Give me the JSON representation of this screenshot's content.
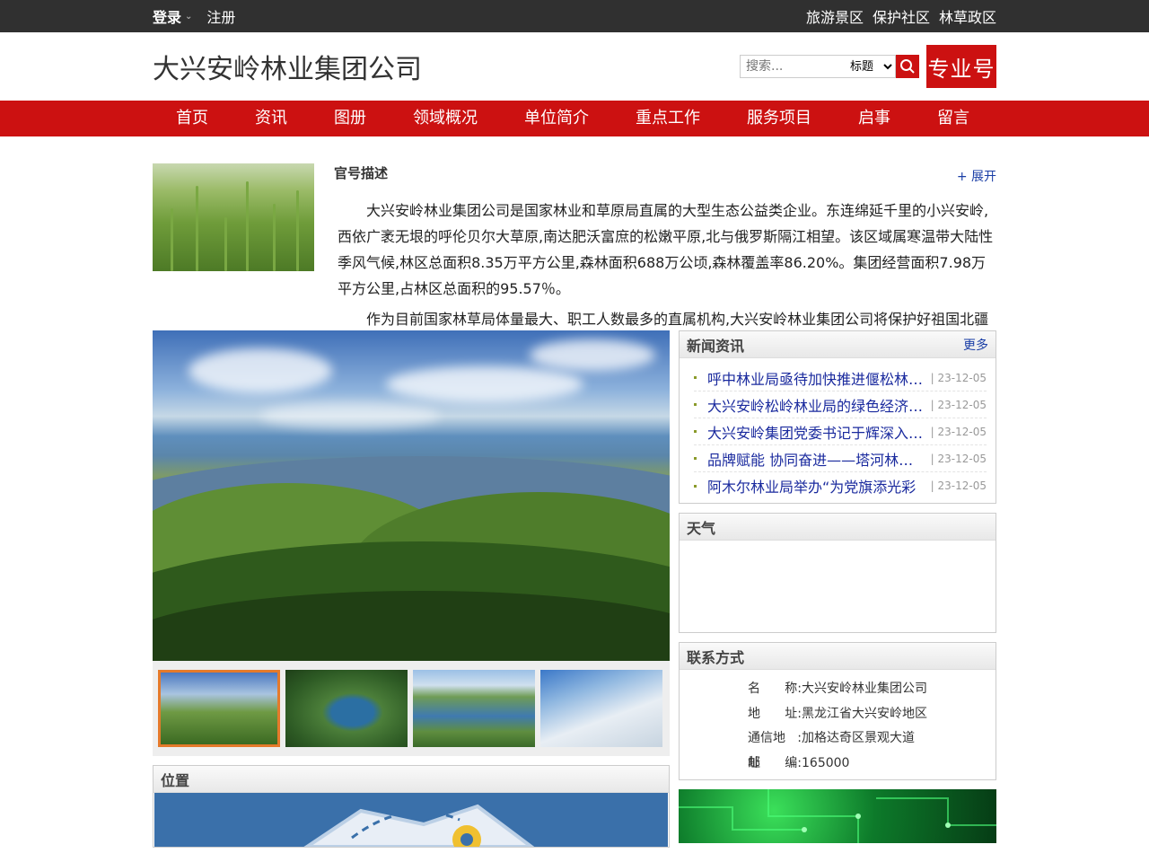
{
  "topbar": {
    "login": "登录",
    "register": "注册",
    "links": [
      "旅游景区",
      "保护社区",
      "林草政区"
    ]
  },
  "header": {
    "title": "大兴安岭林业集团公司",
    "search_placeholder": "搜索...",
    "search_scope": "标题",
    "pro_badge": "专业号"
  },
  "nav": [
    "首页",
    "资讯",
    "图册",
    "领域概况",
    "单位简介",
    "重点工作",
    "服务项目",
    "启事",
    "留言"
  ],
  "intro": {
    "label": "官号描述",
    "expand": "+ 展开",
    "para1": "大兴安岭林业集团公司是国家林业和草原局直属的大型生态公益类企业。东连绵延千里的小兴安岭,西依广袤无垠的呼伦贝尔大草原,南达肥沃富庶的松嫩平原,北与俄罗斯隔江相望。该区域属寒温带大陆性季风气候,林区总面积8.35万平方公里,森林面积688万公顷,森林覆盖率86.20%。集团经营面积7.98万平方公里,占林区总面积的95.57％。",
    "para2": "作为目前国家林草局体量最大、职工人数最多的直属机构,大兴安岭林业集团公司将保护好祖国北疆",
    "ellipsis": "..."
  },
  "news": {
    "title": "新闻资讯",
    "more": "更多",
    "items": [
      {
        "title": "呼中林业局亟待加快推进偃松林地补植工作",
        "date": "| 23-12-05"
      },
      {
        "title": "大兴安岭松岭林业局的绿色经济发展",
        "date": "| 23-12-05"
      },
      {
        "title": "大兴安岭集团党委书记于辉深入调研",
        "date": "| 23-12-05"
      },
      {
        "title": "品牌赋能 协同奋进——塔河林业局",
        "date": "| 23-12-05"
      },
      {
        "title": "阿木尔林业局举办“为党旗添光彩",
        "date": "| 23-12-05"
      }
    ]
  },
  "weather": {
    "title": "天气"
  },
  "contact": {
    "title": "联系方式",
    "rows": [
      {
        "label_a": "名",
        "label_b": "称:",
        "value": "大兴安岭林业集团公司"
      },
      {
        "label_a": "地",
        "label_b": "址:",
        "value": "黑龙江省大兴安岭地区"
      },
      {
        "label_a": "通信地址",
        "label_b": ":",
        "value": "加格达奇区景观大道"
      },
      {
        "label_a": "邮",
        "label_b": "编:",
        "value": "165000"
      }
    ]
  },
  "location": {
    "title": "位置"
  },
  "colors": {
    "brand_red": "#cc1111",
    "topbar": "#303030",
    "link_blue": "#1a2a9e"
  }
}
